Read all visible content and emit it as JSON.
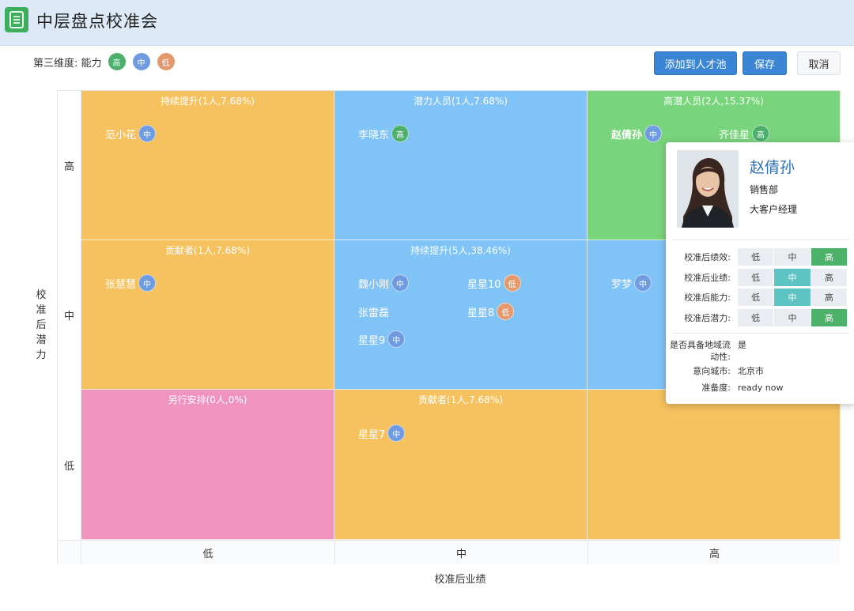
{
  "app": {
    "title": "中层盘点校准会",
    "logo_icon": "document-icon"
  },
  "dimension": {
    "label": "第三维度: 能力",
    "levels": [
      {
        "label": "高",
        "color": "#4caf6c"
      },
      {
        "label": "中",
        "color": "#6f9be0"
      },
      {
        "label": "低",
        "color": "#e4996c"
      }
    ]
  },
  "toolbar": {
    "add_label": "添加到人才池",
    "save_label": "保存",
    "cancel_label": "取消"
  },
  "axes": {
    "y_title": [
      "校",
      "准",
      "后",
      "潜",
      "力"
    ],
    "y_levels": [
      "高",
      "中",
      "低"
    ],
    "x_title": "校准后业绩",
    "x_levels": [
      "低",
      "中",
      "高"
    ]
  },
  "grid": {
    "high_low": {
      "title": "持续提升(1人,7.68%)",
      "people": [
        {
          "name": "范小花",
          "level": "中"
        }
      ]
    },
    "high_mid": {
      "title": "潜力人员(1人,7.68%)",
      "people": [
        {
          "name": "李晓东",
          "level": "高"
        }
      ]
    },
    "high_high": {
      "title": "高潜人员(2人,15.37%)",
      "people": [
        {
          "name": "赵倩孙",
          "level": "中"
        },
        {
          "name": "齐佳星",
          "level": "高"
        }
      ]
    },
    "mid_low": {
      "title": "贡献者(1人,7.68%)",
      "people": [
        {
          "name": "张慧慧",
          "level": "中"
        }
      ]
    },
    "mid_mid": {
      "title": "持续提升(5人,38.46%)",
      "people": [
        {
          "name": "魏小刚",
          "level": "中"
        },
        {
          "name": "星星10",
          "level": "低"
        },
        {
          "name": "张雷磊",
          "level": ""
        },
        {
          "name": "星星8",
          "level": "低"
        },
        {
          "name": "星星9",
          "level": "中"
        }
      ]
    },
    "mid_high": {
      "title": "",
      "people": [
        {
          "name": "罗梦",
          "level": "中"
        }
      ]
    },
    "low_low": {
      "title": "另行安排(0人,0%)",
      "people": []
    },
    "low_mid": {
      "title": "贡献者(1人,7.68%)",
      "people": [
        {
          "name": "星星7",
          "level": "中"
        }
      ]
    },
    "low_high": {
      "title": "",
      "people": []
    }
  },
  "cell_colors": {
    "orange": "#f6c25f",
    "blue": "#80c3f7",
    "green": "#79d57b",
    "pink": "#f093bf"
  },
  "profile": {
    "name": "赵倩孙",
    "department": "销售部",
    "role": "大客户经理",
    "ratings": [
      {
        "label": "校准后绩效:",
        "options": [
          "低",
          "中",
          "高"
        ],
        "selected": "高"
      },
      {
        "label": "校准后业绩:",
        "options": [
          "低",
          "中",
          "高"
        ],
        "selected": "中"
      },
      {
        "label": "校准后能力:",
        "options": [
          "低",
          "中",
          "高"
        ],
        "selected": "中"
      },
      {
        "label": "校准后潜力:",
        "options": [
          "低",
          "中",
          "高"
        ],
        "selected": "高"
      }
    ],
    "mobility_label": "是否具备地域流动性:",
    "mobility_value": "是",
    "city_label": "意向城市:",
    "city_value": "北京市",
    "readiness_label": "准备度:",
    "readiness_value": "ready now"
  }
}
